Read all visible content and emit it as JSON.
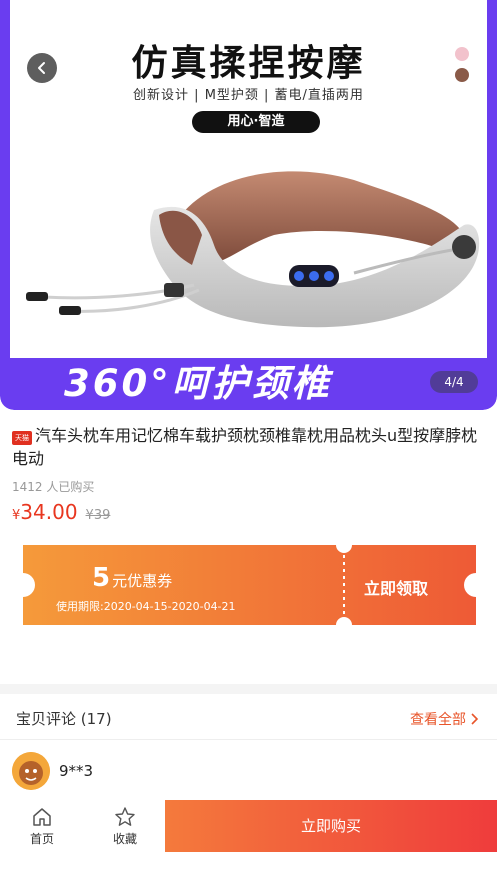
{
  "hero": {
    "title": "仿真揉捏按摩",
    "subtitle": "创新设计 | M型护颈 | 蓄电/直插两用",
    "pill": "用心·智造",
    "banner": "360°呵护颈椎",
    "page_indicator": "4/4",
    "colors": {
      "frame": "#6a3df0",
      "pillow_gray": "#d8d8d8",
      "pillow_brown": "#a46b55"
    },
    "icons": [
      "back-arrow-icon",
      "color-swatch-pink",
      "color-swatch-brown"
    ]
  },
  "product": {
    "badge": "天猫",
    "title": "汽车头枕车用记忆棉车载护颈枕颈椎靠枕用品枕头u型按摩脖枕电动",
    "sold": "1412 人已购买",
    "price_symbol": "¥",
    "price": "34.00",
    "original_price": "¥39",
    "accent_color": "#e8361f"
  },
  "coupon": {
    "amount": "5",
    "amount_suffix": "元优惠券",
    "period": "使用期限:2020-04-15-2020-04-21",
    "action": "立即领取",
    "gradient": [
      "#f59a3a",
      "#ee5a36"
    ]
  },
  "reviews": {
    "title": "宝贝评论 (17)",
    "view_all": "查看全部",
    "reviewer_name": "9**3"
  },
  "bottom_bar": {
    "home_label": "首页",
    "favorite_label": "收藏",
    "buy_label": "立即购买"
  }
}
